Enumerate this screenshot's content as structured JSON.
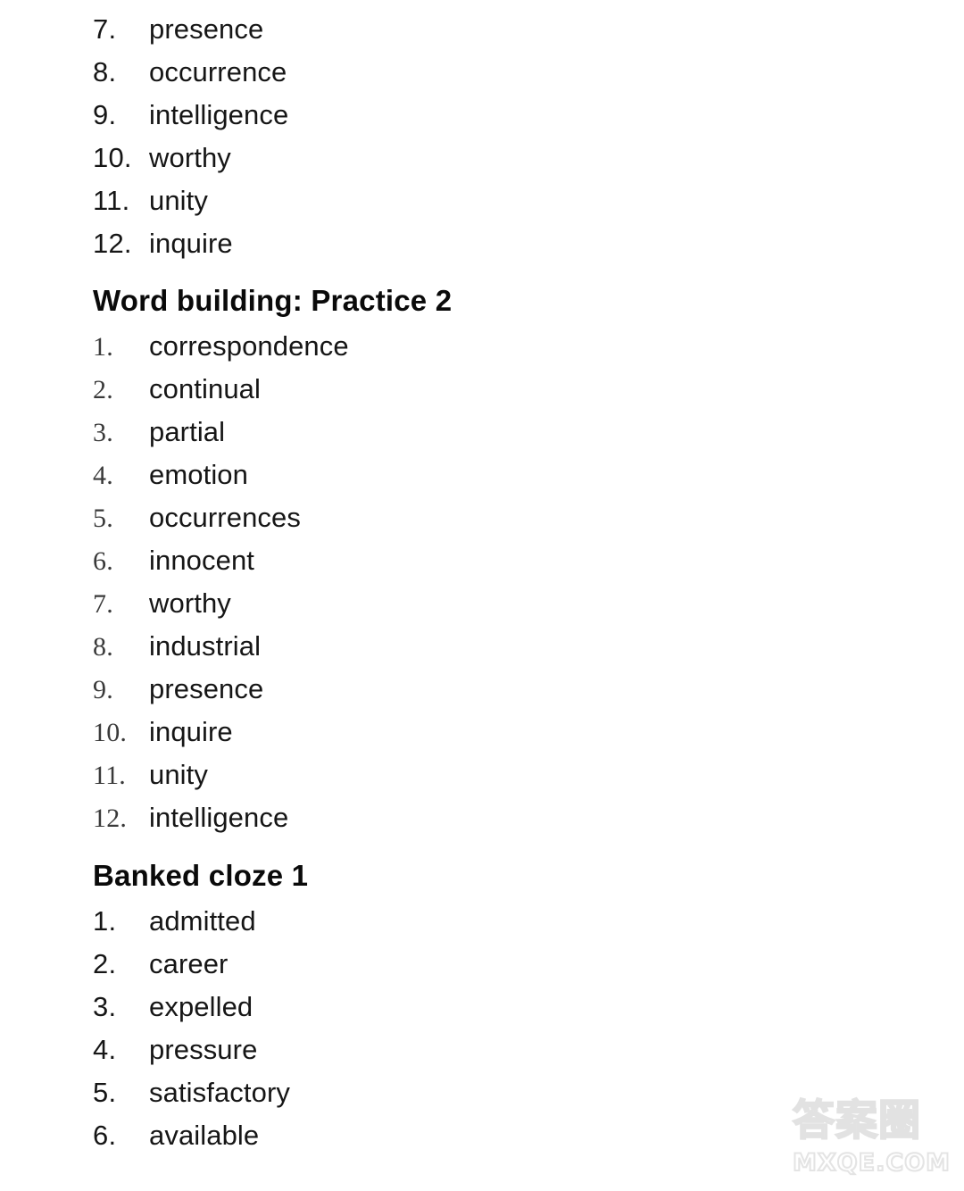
{
  "document": {
    "background_color": "#ffffff",
    "text_color": "#161616"
  },
  "sections": [
    {
      "id": "word-building-practice-1-tail",
      "heading": null,
      "number_style": "sans",
      "items": [
        {
          "number": "7.",
          "word": "presence"
        },
        {
          "number": "8.",
          "word": "occurrence"
        },
        {
          "number": "9.",
          "word": "intelligence"
        },
        {
          "number": "10.",
          "word": "worthy"
        },
        {
          "number": "11.",
          "word": "unity"
        },
        {
          "number": "12.",
          "word": "inquire"
        }
      ]
    },
    {
      "id": "word-building-practice-2",
      "heading": "Word building: Practice 2",
      "number_style": "serif",
      "items": [
        {
          "number": "1.",
          "word": "correspondence"
        },
        {
          "number": "2.",
          "word": "continual"
        },
        {
          "number": "3.",
          "word": "partial"
        },
        {
          "number": "4.",
          "word": "emotion"
        },
        {
          "number": "5.",
          "word": "occurrences"
        },
        {
          "number": "6.",
          "word": "innocent"
        },
        {
          "number": "7.",
          "word": "worthy"
        },
        {
          "number": "8.",
          "word": "industrial"
        },
        {
          "number": "9.",
          "word": "presence"
        },
        {
          "number": "10.",
          "word": "inquire"
        },
        {
          "number": "11.",
          "word": "unity"
        },
        {
          "number": "12.",
          "word": "intelligence"
        }
      ]
    },
    {
      "id": "banked-cloze-1",
      "heading": "Banked cloze 1",
      "number_style": "sans",
      "items": [
        {
          "number": "1.",
          "word": "admitted"
        },
        {
          "number": "2.",
          "word": "career"
        },
        {
          "number": "3.",
          "word": "expelled"
        },
        {
          "number": "4.",
          "word": "pressure"
        },
        {
          "number": "5.",
          "word": "satisfactory"
        },
        {
          "number": "6.",
          "word": "available"
        }
      ]
    }
  ],
  "watermark": {
    "characters": "答案圈",
    "domain": "MXQE.COM",
    "color": "#e4e4e4"
  }
}
